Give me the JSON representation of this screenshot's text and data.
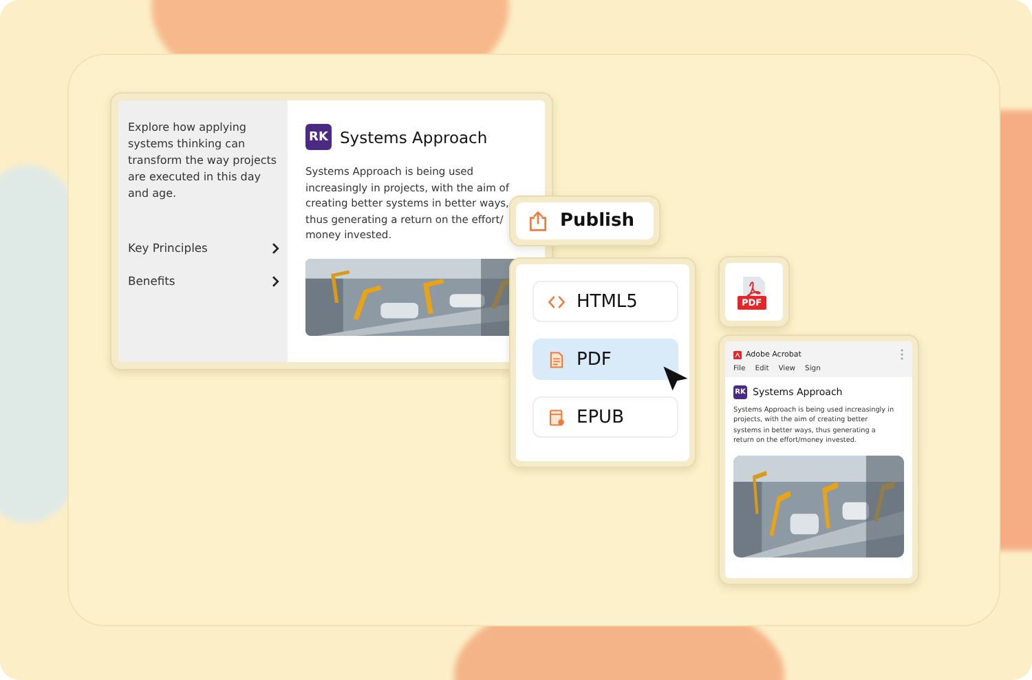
{
  "course": {
    "intro": "Explore how applying systems thinking can transform the way projects are executed in this day and age.",
    "nav_items": [
      {
        "label": "Key Principles"
      },
      {
        "label": "Benefits"
      }
    ],
    "logo": "RK",
    "title": "Systems Approach",
    "body": "Systems Approach is being used increasingly in projects, with the aim of creating better systems in better ways, thus generating a return on the effort/ money invested."
  },
  "publish": {
    "label": "Publish"
  },
  "formats": [
    {
      "label": "HTML5",
      "kind": "code",
      "selected": false
    },
    {
      "label": "PDF",
      "kind": "doc",
      "selected": true
    },
    {
      "label": "EPUB",
      "kind": "book",
      "selected": false
    }
  ],
  "file_badge": "PDF",
  "acrobat": {
    "app_name": "Adobe Acrobat",
    "menu": [
      "File",
      "Edit",
      "View",
      "Sign"
    ],
    "logo": "RK",
    "title": "Systems Approach",
    "body": "Systems Approach is being used increasingly in projects, with the aim of creating better systems in better ways, thus generating a return on the effort/money invested."
  }
}
